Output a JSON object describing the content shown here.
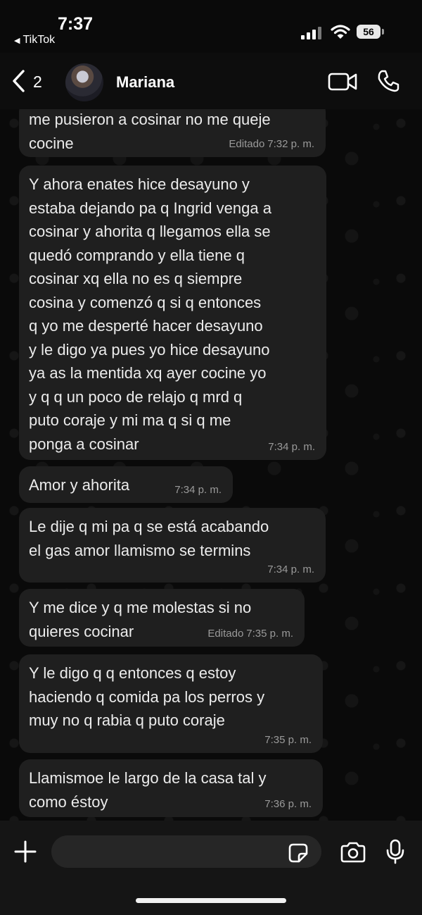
{
  "status_bar": {
    "time": "7:37",
    "back_app": "TikTok",
    "battery": "56"
  },
  "header": {
    "back_count": "2",
    "contact_name": "Mariana"
  },
  "messages": [
    {
      "text": "me pusieron a cosinar no me queje\ncocine",
      "edited": "Editado",
      "time": "7:32 p. m."
    },
    {
      "text": "Y ahora enates hice desayuno y\nestaba dejando pa q Ingrid venga a\ncosinar y ahorita q llegamos ella se\nquedó comprando y ella tiene q\ncosinar xq ella no es q siempre\ncosina y comenzó q si q entonces\nq yo me desperté hacer desayuno\ny le digo ya pues yo hice desayuno\nya as la mentida xq ayer cocine yo\ny q q un poco de relajo q mrd q\nputo coraje y mi ma q si q me\nponga a cosinar",
      "edited": "",
      "time": "7:34 p. m."
    },
    {
      "text": "Amor y ahorita",
      "edited": "",
      "time": "7:34 p. m."
    },
    {
      "text": "Le dije q mi pa q se está acabando\nel gas amor llamismo se termins",
      "edited": "",
      "time": "7:34 p. m."
    },
    {
      "text": "Y me dice y q me molestas si no\nquieres cocinar",
      "edited": "Editado",
      "time": "7:35 p. m."
    },
    {
      "text": "Y le digo q q entonces q estoy\nhaciendo q comida pa los perros y\nmuy no q rabia q puto coraje",
      "edited": "",
      "time": "7:35 p. m."
    },
    {
      "text": "Llamismoe le largo de la casa tal y\ncomo éstoy",
      "edited": "",
      "time": "7:36 p. m."
    }
  ],
  "icons": {
    "back": "chevron-left-icon",
    "video": "video-camera-icon",
    "call": "phone-icon",
    "plus": "plus-icon",
    "sticker": "sticker-icon",
    "camera": "camera-icon",
    "mic": "microphone-icon"
  },
  "colors": {
    "background": "#0b0b0b",
    "bubble": "#1f1f1f",
    "text": "#ececec",
    "meta": "#9a9a9a"
  }
}
